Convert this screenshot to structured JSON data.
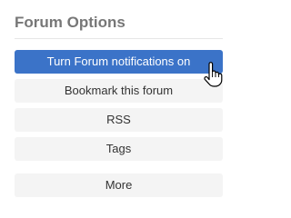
{
  "panel": {
    "title": "Forum Options",
    "buttons": {
      "notifications": "Turn Forum notifications on",
      "bookmark": "Bookmark this forum",
      "rss": "RSS",
      "tags": "Tags",
      "more": "More"
    }
  },
  "colors": {
    "primary": "#3b73c8",
    "button_bg": "#f4f4f4",
    "title_text": "#777777"
  },
  "icons": {
    "cursor": "hand-pointer-icon"
  }
}
